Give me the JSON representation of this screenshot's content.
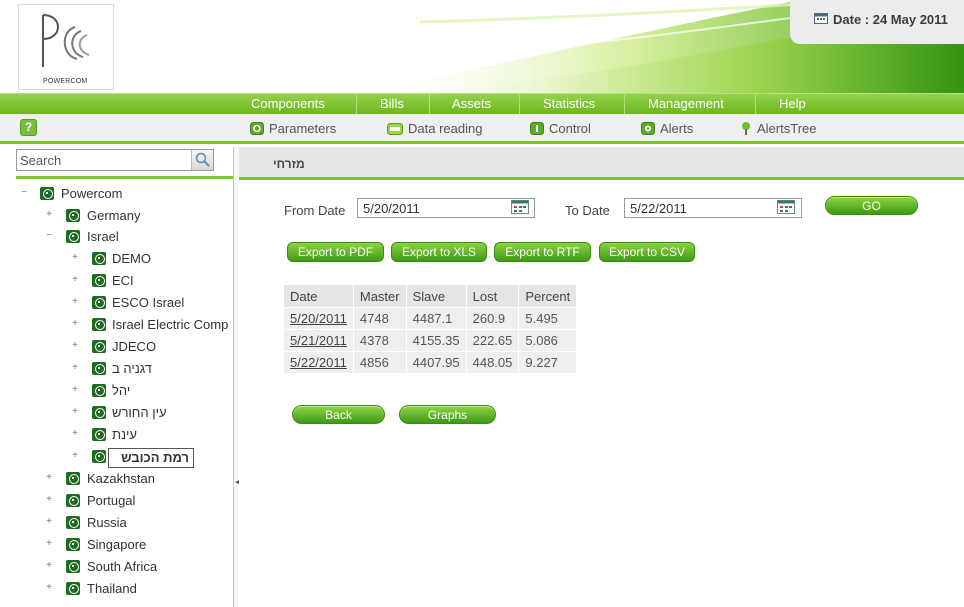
{
  "header": {
    "logo_text": "POWERCOM",
    "date_text": "Date : 24 May 2011"
  },
  "main_menu": [
    {
      "label": "Components"
    },
    {
      "label": "Bills"
    },
    {
      "label": "Assets"
    },
    {
      "label": "Statistics"
    },
    {
      "label": "Management"
    },
    {
      "label": "Help"
    }
  ],
  "sub_menu": [
    {
      "label": "Parameters",
      "icon": "parameters-icon"
    },
    {
      "label": "Data reading",
      "icon": "data-reading-icon"
    },
    {
      "label": "Control",
      "icon": "control-icon"
    },
    {
      "label": "Alerts",
      "icon": "alerts-icon"
    },
    {
      "label": "AlertsTree",
      "icon": "alerts-tree-icon"
    }
  ],
  "sidebar": {
    "search_placeholder": "Search",
    "tree": [
      {
        "label": "Powercom",
        "toggle": "−",
        "level": 0
      },
      {
        "label": "Germany",
        "toggle": "+",
        "level": 1
      },
      {
        "label": "Israel",
        "toggle": "−",
        "level": 1
      },
      {
        "label": "DEMO",
        "toggle": "+",
        "level": 2
      },
      {
        "label": "ECI",
        "toggle": "+",
        "level": 2
      },
      {
        "label": "ESCO Israel",
        "toggle": "+",
        "level": 2
      },
      {
        "label": "Israel Electric Comp",
        "toggle": "+",
        "level": 2
      },
      {
        "label": "JDECO",
        "toggle": "+",
        "level": 2
      },
      {
        "label": "דגניה ב",
        "toggle": "+",
        "level": 2
      },
      {
        "label": "יהל",
        "toggle": "+",
        "level": 2
      },
      {
        "label": "עין החורש",
        "toggle": "+",
        "level": 2
      },
      {
        "label": "עינת",
        "toggle": "+",
        "level": 2
      },
      {
        "label": "רמת הכובש",
        "toggle": "+",
        "level": 2,
        "selected": true
      },
      {
        "label": "Kazakhstan",
        "toggle": "+",
        "level": 1
      },
      {
        "label": "Portugal",
        "toggle": "+",
        "level": 1
      },
      {
        "label": "Russia",
        "toggle": "+",
        "level": 1
      },
      {
        "label": "Singapore",
        "toggle": "+",
        "level": 1
      },
      {
        "label": "South Africa",
        "toggle": "+",
        "level": 1
      },
      {
        "label": "Thailand",
        "toggle": "+",
        "level": 1
      }
    ]
  },
  "main": {
    "title": "מזרחי",
    "from_label": "From Date",
    "from_value": "5/20/2011",
    "to_label": "To Date",
    "to_value": "5/22/2011",
    "go_label": "GO",
    "exports": [
      {
        "label": "Export to PDF"
      },
      {
        "label": "Export to XLS"
      },
      {
        "label": "Export to RTF"
      },
      {
        "label": "Export to CSV"
      }
    ],
    "table": {
      "columns": [
        "Date",
        "Master",
        "Slave",
        "Lost",
        "Percent"
      ],
      "rows": [
        [
          "5/20/2011",
          "4748",
          "4487.1",
          "260.9",
          "5.495"
        ],
        [
          "5/21/2011",
          "4378",
          "4155.35",
          "222.65",
          "5.086"
        ],
        [
          "5/22/2011",
          "4856",
          "4407.95",
          "448.05",
          "9.227"
        ]
      ]
    },
    "back_label": "Back",
    "graphs_label": "Graphs"
  },
  "colors": {
    "accent_green": "#7cc52a",
    "menu_green": "#6cb61f",
    "button_green": "#3d9a14"
  }
}
